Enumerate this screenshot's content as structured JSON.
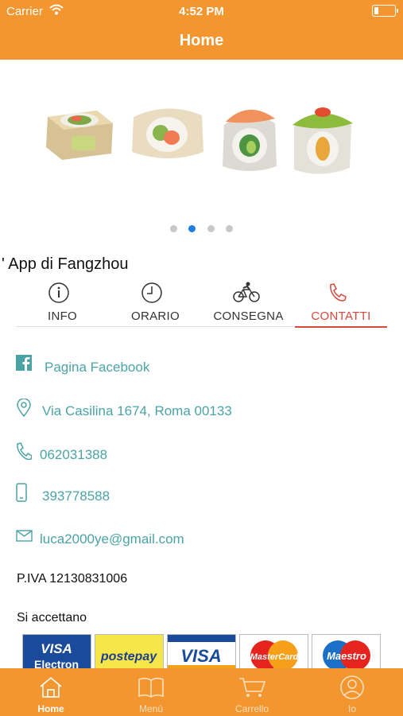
{
  "status_bar": {
    "carrier": "Carrier",
    "time": "4:52 PM"
  },
  "header": {
    "title": "Home"
  },
  "carousel": {
    "page_count": 4,
    "active_index": 1
  },
  "store": {
    "name": "' App di Fangzhou"
  },
  "tabs": [
    {
      "label": "INFO",
      "icon": "info-icon"
    },
    {
      "label": "ORARIO",
      "icon": "clock-icon"
    },
    {
      "label": "CONSEGNA",
      "icon": "bicycle-icon"
    },
    {
      "label": "CONTATTI",
      "icon": "phone-icon",
      "active": true
    }
  ],
  "contacts": {
    "facebook": "Pagina Facebook",
    "address": "Via Casilina 1674, Roma 00133",
    "phone": "062031388",
    "mobile": "393778588",
    "email": "luca2000ye@gmail.com"
  },
  "vat": "P.IVA 12130831006",
  "payments": {
    "heading": "Si accettano",
    "cards": [
      "VISA Electron",
      "postepay",
      "VISA",
      "MasterCard",
      "Maestro"
    ]
  },
  "tabbar": [
    {
      "label": "Home",
      "icon": "home-icon",
      "active": true
    },
    {
      "label": "Menù",
      "icon": "book-icon"
    },
    {
      "label": "Carrello",
      "icon": "cart-icon"
    },
    {
      "label": "Io",
      "icon": "user-icon"
    }
  ],
  "colors": {
    "accent": "#f3962f",
    "link": "#4ba3a6",
    "active_tab": "#d9483b",
    "dot_active": "#1f7fe0"
  }
}
